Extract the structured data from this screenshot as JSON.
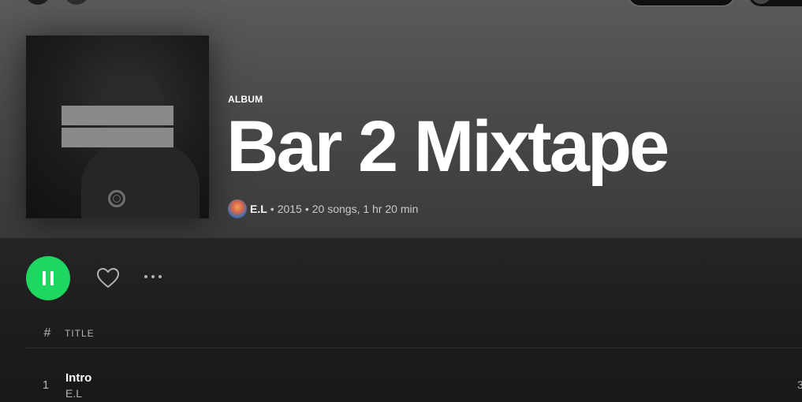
{
  "header": {
    "type_label": "ALBUM",
    "title": "Bar 2 Mixtape",
    "artist": "E.L",
    "separator": "•",
    "year": "2015",
    "stats": "20 songs, 1 hr 20 min"
  },
  "actions": {
    "play_state": "playing",
    "icons": [
      "pause-icon",
      "heart-icon",
      "more-options-icon"
    ]
  },
  "table": {
    "columns": {
      "number": "#",
      "title": "TITLE"
    },
    "tracks": [
      {
        "number": "1",
        "title": "Intro",
        "artist": "E.L",
        "duration": "3"
      }
    ]
  },
  "colors": {
    "accent": "#1ed760",
    "hero_top": "#5a5a5a",
    "background": "#181818"
  }
}
